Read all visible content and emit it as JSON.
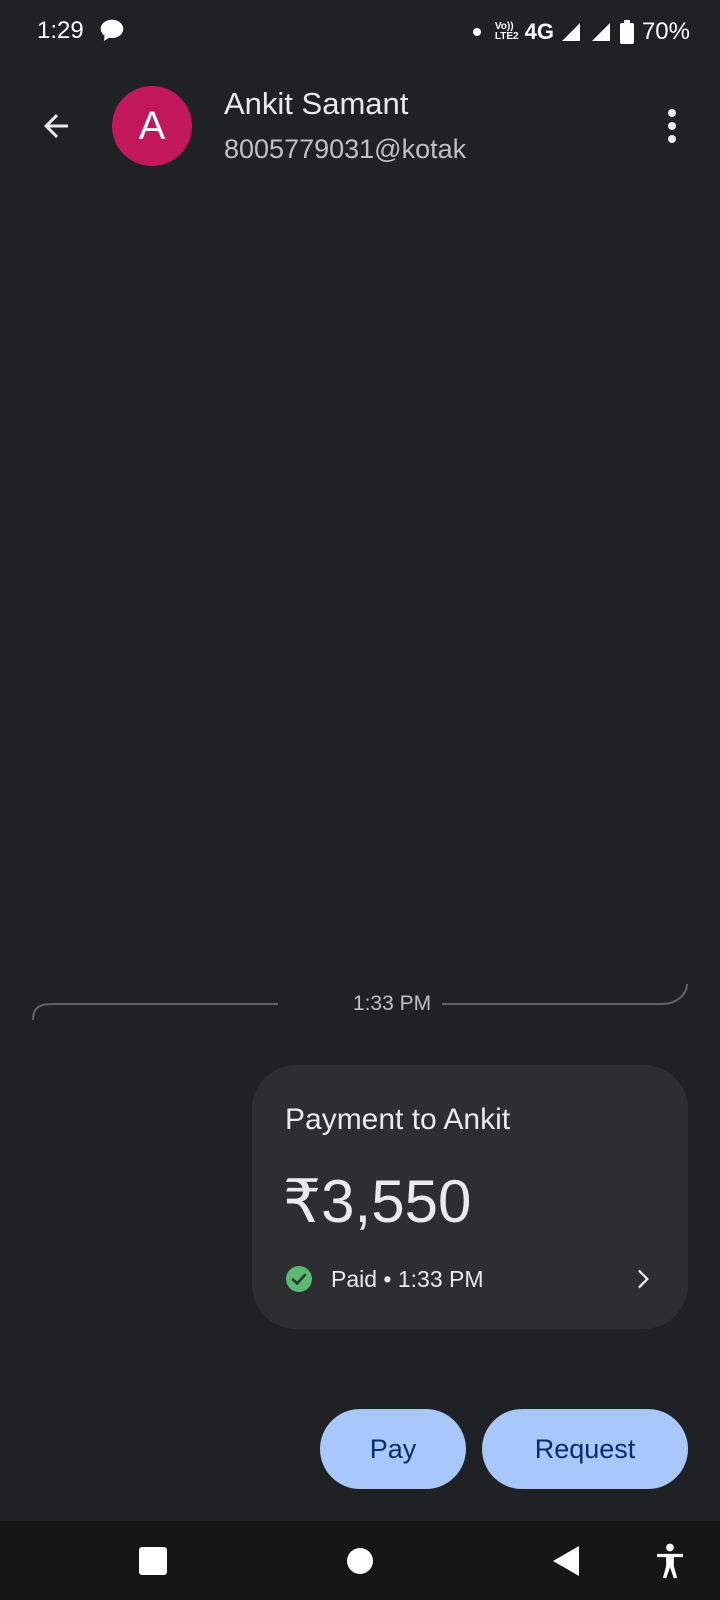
{
  "status_bar": {
    "time": "1:29",
    "volte_top": "Vo))",
    "volte_bottom": "LTE2",
    "network": "4G",
    "battery": "70%",
    "icons": [
      "message-icon",
      "dot-icon",
      "volte-icon",
      "signal-icon",
      "signal-icon",
      "battery-icon"
    ]
  },
  "header": {
    "back_icon": "arrow-back-icon",
    "avatar_letter": "A",
    "avatar_color": "#c2185b",
    "name": "Ankit Samant",
    "upi_id": "8005779031@kotak",
    "more_icon": "more-vert-icon"
  },
  "thread": {
    "timestamp": "1:33 PM"
  },
  "payment": {
    "title": "Payment to Ankit",
    "amount": "₹3,550",
    "status": "Paid • 1:33 PM",
    "status_icon": "check-circle-icon",
    "status_color": "#5bb974",
    "chevron_icon": "chevron-right-icon"
  },
  "actions": {
    "pay_label": "Pay",
    "request_label": "Request",
    "button_color": "#a8c7fa"
  },
  "nav_bar": {
    "icons": [
      "recents-square-icon",
      "home-circle-icon",
      "back-triangle-icon",
      "accessibility-icon"
    ]
  }
}
